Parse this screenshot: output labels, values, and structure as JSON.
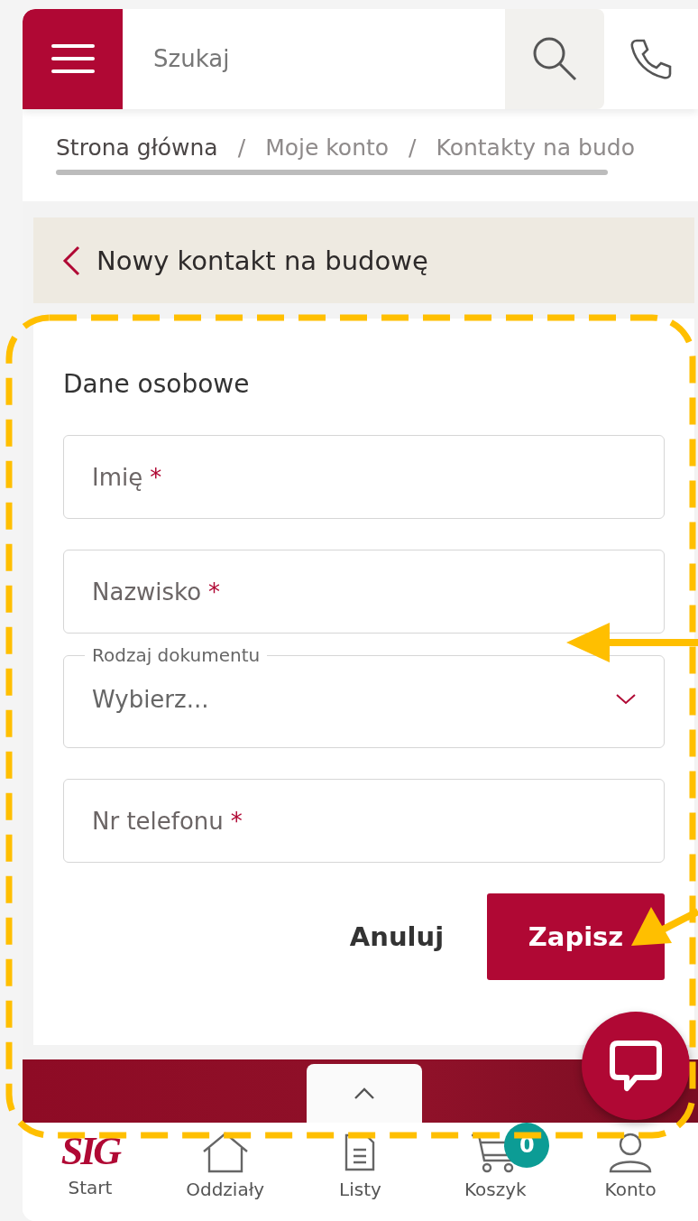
{
  "header": {
    "search": {
      "placeholder": "Szukaj"
    }
  },
  "breadcrumbs": [
    {
      "label": "Strona główna",
      "emphasized": true
    },
    {
      "label": "Moje konto",
      "emphasized": false
    },
    {
      "label": "Kontakty na budo",
      "emphasized": false
    }
  ],
  "breadcrumb_separator": "/",
  "page_title": "Nowy kontakt na budowę",
  "form": {
    "section_title": "Dane osobowe",
    "fields": [
      {
        "kind": "text",
        "label": "Imię",
        "required_mark": "*"
      },
      {
        "kind": "text",
        "label": "Nazwisko",
        "required_mark": "*"
      },
      {
        "kind": "select",
        "label": "Rodzaj dokumentu",
        "placeholder": "Wybierz..."
      },
      {
        "kind": "text",
        "label": "Nr telefonu",
        "required_mark": "*"
      }
    ],
    "buttons": [
      {
        "kind": "secondary",
        "label": "Anuluj"
      },
      {
        "kind": "primary",
        "label": "Zapisz"
      }
    ]
  },
  "bottom_nav": [
    {
      "kind": "logo",
      "logo": "SIG",
      "label": "Start"
    },
    {
      "kind": "home",
      "label": "Oddziały"
    },
    {
      "kind": "list",
      "label": "Listy"
    },
    {
      "kind": "cart",
      "label": "Koszyk",
      "badge": "0"
    },
    {
      "kind": "user",
      "label": "Konto"
    }
  ]
}
